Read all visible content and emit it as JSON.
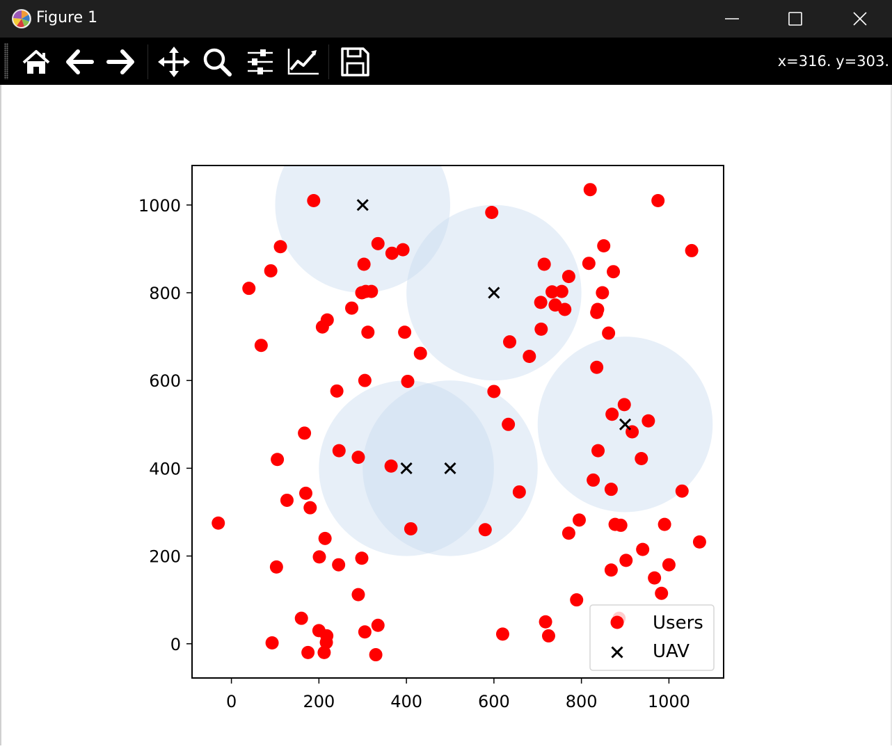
{
  "window": {
    "title": "Figure 1",
    "controls": [
      "minimize",
      "maximize",
      "close"
    ]
  },
  "toolbar": {
    "buttons": [
      {
        "name": "home",
        "icon": "home-icon"
      },
      {
        "name": "back",
        "icon": "arrow-left-icon"
      },
      {
        "name": "forward",
        "icon": "arrow-right-icon"
      },
      {
        "name": "pan",
        "icon": "move-icon"
      },
      {
        "name": "zoom",
        "icon": "magnifier-icon"
      },
      {
        "name": "configure-subplots",
        "icon": "sliders-icon"
      },
      {
        "name": "edit-axes",
        "icon": "line-chart-icon"
      },
      {
        "name": "save",
        "icon": "floppy-disk-icon"
      }
    ],
    "coords": "x=316. y=303."
  },
  "colors": {
    "titlebar_bg": "#1f1f1f",
    "toolbar_bg": "#000000",
    "user_marker": "#ff0000",
    "uav_marker": "#000000",
    "coverage_fill": "#c6d9ee"
  },
  "chart_data": {
    "type": "scatter",
    "xlim": [
      -90,
      1125
    ],
    "ylim": [
      -78,
      1090
    ],
    "xticks": [
      0,
      200,
      400,
      600,
      800,
      1000
    ],
    "yticks": [
      0,
      200,
      400,
      600,
      800,
      1000
    ],
    "grid": false,
    "legend_position": "lower right",
    "coverage": {
      "radius": 200,
      "centers": [
        [
          300,
          1000
        ],
        [
          600,
          800
        ],
        [
          400,
          400
        ],
        [
          500,
          400
        ],
        [
          900,
          500
        ]
      ]
    },
    "series": [
      {
        "name": "Users",
        "marker": "circle",
        "color": "#ff0000",
        "points": [
          [
            188,
            1010
          ],
          [
            595,
            983
          ],
          [
            820,
            1035
          ],
          [
            975,
            1010
          ],
          [
            112,
            905
          ],
          [
            335,
            912
          ],
          [
            367,
            890
          ],
          [
            392,
            898
          ],
          [
            851,
            907
          ],
          [
            1052,
            896
          ],
          [
            90,
            850
          ],
          [
            303,
            865
          ],
          [
            715,
            865
          ],
          [
            817,
            867
          ],
          [
            873,
            848
          ],
          [
            40,
            810
          ],
          [
            298,
            800
          ],
          [
            307,
            803
          ],
          [
            320,
            803
          ],
          [
            755,
            803
          ],
          [
            733,
            802
          ],
          [
            771,
            837
          ],
          [
            848,
            800
          ],
          [
            275,
            765
          ],
          [
            740,
            772
          ],
          [
            707,
            778
          ],
          [
            762,
            762
          ],
          [
            837,
            762
          ],
          [
            835,
            755
          ],
          [
            219,
            738
          ],
          [
            208,
            722
          ],
          [
            312,
            710
          ],
          [
            396,
            710
          ],
          [
            708,
            717
          ],
          [
            862,
            708
          ],
          [
            68,
            680
          ],
          [
            636,
            688
          ],
          [
            432,
            662
          ],
          [
            681,
            655
          ],
          [
            305,
            600
          ],
          [
            403,
            598
          ],
          [
            241,
            576
          ],
          [
            600,
            575
          ],
          [
            835,
            630
          ],
          [
            898,
            545
          ],
          [
            953,
            508
          ],
          [
            870,
            523
          ],
          [
            633,
            500
          ],
          [
            167,
            480
          ],
          [
            916,
            483
          ],
          [
            246,
            440
          ],
          [
            290,
            425
          ],
          [
            838,
            440
          ],
          [
            937,
            422
          ],
          [
            105,
            420
          ],
          [
            365,
            405
          ],
          [
            170,
            343
          ],
          [
            658,
            346
          ],
          [
            868,
            352
          ],
          [
            1030,
            348
          ],
          [
            127,
            327
          ],
          [
            827,
            373
          ],
          [
            180,
            310
          ],
          [
            -30,
            275
          ],
          [
            410,
            262
          ],
          [
            580,
            260
          ],
          [
            795,
            282
          ],
          [
            877,
            272
          ],
          [
            890,
            270
          ],
          [
            990,
            272
          ],
          [
            214,
            240
          ],
          [
            771,
            252
          ],
          [
            1070,
            232
          ],
          [
            940,
            215
          ],
          [
            201,
            198
          ],
          [
            298,
            195
          ],
          [
            902,
            190
          ],
          [
            103,
            175
          ],
          [
            245,
            180
          ],
          [
            1000,
            180
          ],
          [
            868,
            168
          ],
          [
            967,
            150
          ],
          [
            290,
            112
          ],
          [
            983,
            115
          ],
          [
            789,
            100
          ],
          [
            160,
            58
          ],
          [
            886,
            58
          ],
          [
            335,
            42
          ],
          [
            200,
            30
          ],
          [
            305,
            27
          ],
          [
            218,
            18
          ],
          [
            620,
            22
          ],
          [
            718,
            50
          ],
          [
            725,
            18
          ],
          [
            217,
            3
          ],
          [
            93,
            2
          ],
          [
            175,
            -20
          ],
          [
            212,
            -20
          ],
          [
            330,
            -25
          ]
        ]
      },
      {
        "name": "UAV",
        "marker": "x",
        "color": "#000000",
        "points": [
          [
            300,
            1000
          ],
          [
            600,
            800
          ],
          [
            400,
            400
          ],
          [
            500,
            400
          ],
          [
            900,
            500
          ]
        ]
      }
    ]
  }
}
